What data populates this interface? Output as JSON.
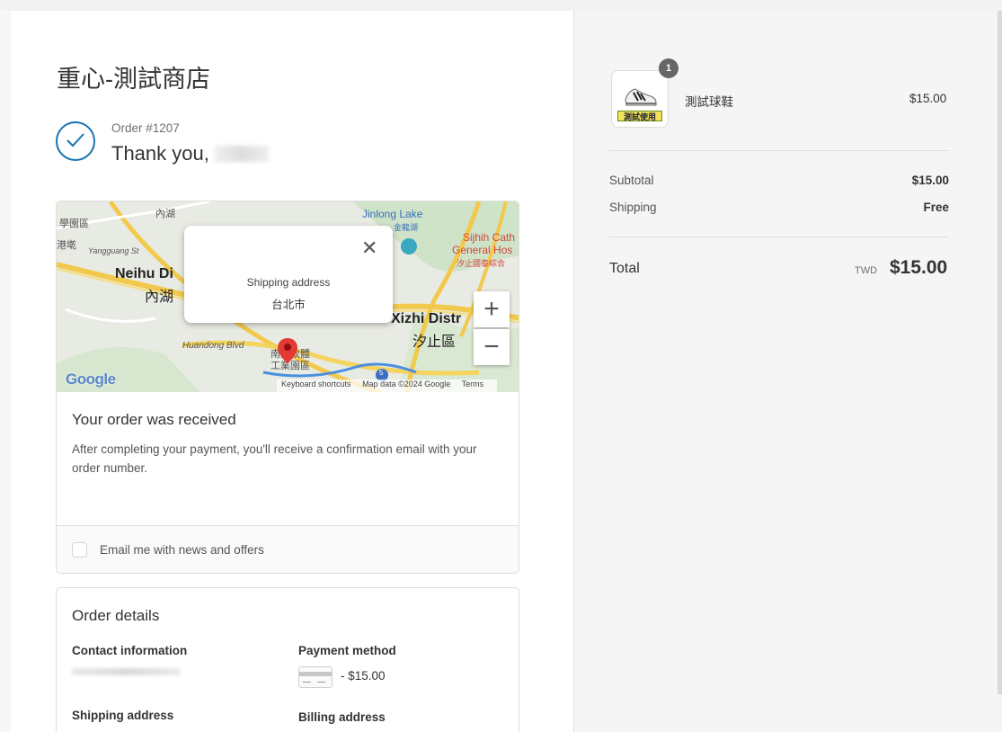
{
  "store": {
    "title": "重心-測試商店"
  },
  "order": {
    "number_label": "Order #1207",
    "thank_you": "Thank you,"
  },
  "map": {
    "popup_title": "Shipping address",
    "popup_city": "台北市",
    "close_glyph": "✕",
    "zoom_in": "+",
    "zoom_out": "−",
    "google": "Google",
    "labels": {
      "neihu_en": "Neihu Di",
      "neihu_zh": "內湖",
      "xizhi_en": "Xizhi Distr",
      "xizhi_zh": "汐止區",
      "jinlong": "Jinlong Lake",
      "jinlong_zh": "金龍湖",
      "sijhih": "Sijhih Cath",
      "general": "General Hos",
      "general_zh": "汐止國泰綜合",
      "neihu_top": "內湖",
      "xue": "學園區",
      "gang": "港墘",
      "yangguang": "Yangguang St",
      "huandong": "Huandong Blvd",
      "nangang": "南港軟體",
      "nangang2": "工業園區",
      "route5": "5"
    },
    "attribution": {
      "shortcuts": "Keyboard shortcuts",
      "mapdata": "Map data ©2024 Google",
      "terms": "Terms"
    }
  },
  "received": {
    "title": "Your order was received",
    "text": "After completing your payment, you'll receive a confirmation email with your order number."
  },
  "email_opt": {
    "label": "Email me with news and offers",
    "checked": false
  },
  "details": {
    "title": "Order details",
    "contact_heading": "Contact information",
    "payment_heading": "Payment method",
    "payment_amount": "- $15.00",
    "shipping_heading": "Shipping address",
    "billing_heading": "Billing address"
  },
  "summary": {
    "item": {
      "name": "測試球鞋",
      "price": "$15.00",
      "quantity": "1",
      "tag": "測試使用"
    },
    "subtotal_label": "Subtotal",
    "subtotal_value": "$15.00",
    "shipping_label": "Shipping",
    "shipping_value": "Free",
    "total_label": "Total",
    "currency": "TWD",
    "total_value": "$15.00"
  },
  "colors": {
    "accent": "#1773b0",
    "panel": "#f5f5f5",
    "border": "#dedede"
  }
}
